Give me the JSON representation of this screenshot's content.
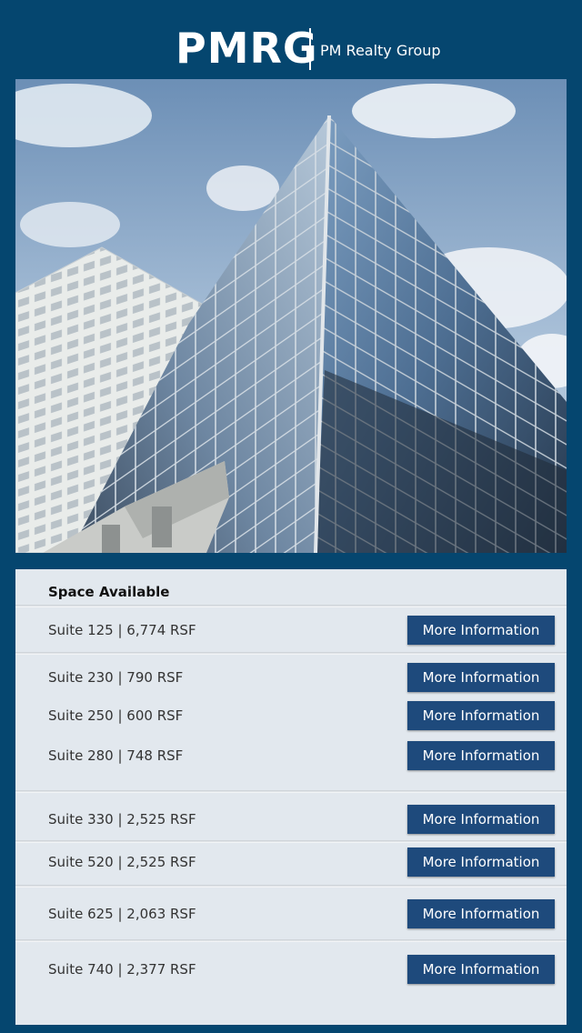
{
  "brand": {
    "mark": "PMRG",
    "name": "PM Realty Group"
  },
  "space_panel": {
    "title": "Space Available",
    "button_label": "More Information",
    "suites": [
      {
        "label": "Suite 125 | 6,774 RSF"
      },
      {
        "label": "Suite 230 | 790 RSF"
      },
      {
        "label": "Suite 250 | 600 RSF"
      },
      {
        "label": "Suite 280 | 748 RSF"
      },
      {
        "label": "Suite 330 | 2,525 RSF"
      },
      {
        "label": "Suite 520 | 2,525 RSF"
      },
      {
        "label": "Suite 625 | 2,063 RSF"
      },
      {
        "label": "Suite 740 | 2,377 RSF"
      }
    ]
  },
  "colors": {
    "background": "#05466f",
    "panel": "#e2e8ee",
    "button": "#1e4a7c"
  }
}
